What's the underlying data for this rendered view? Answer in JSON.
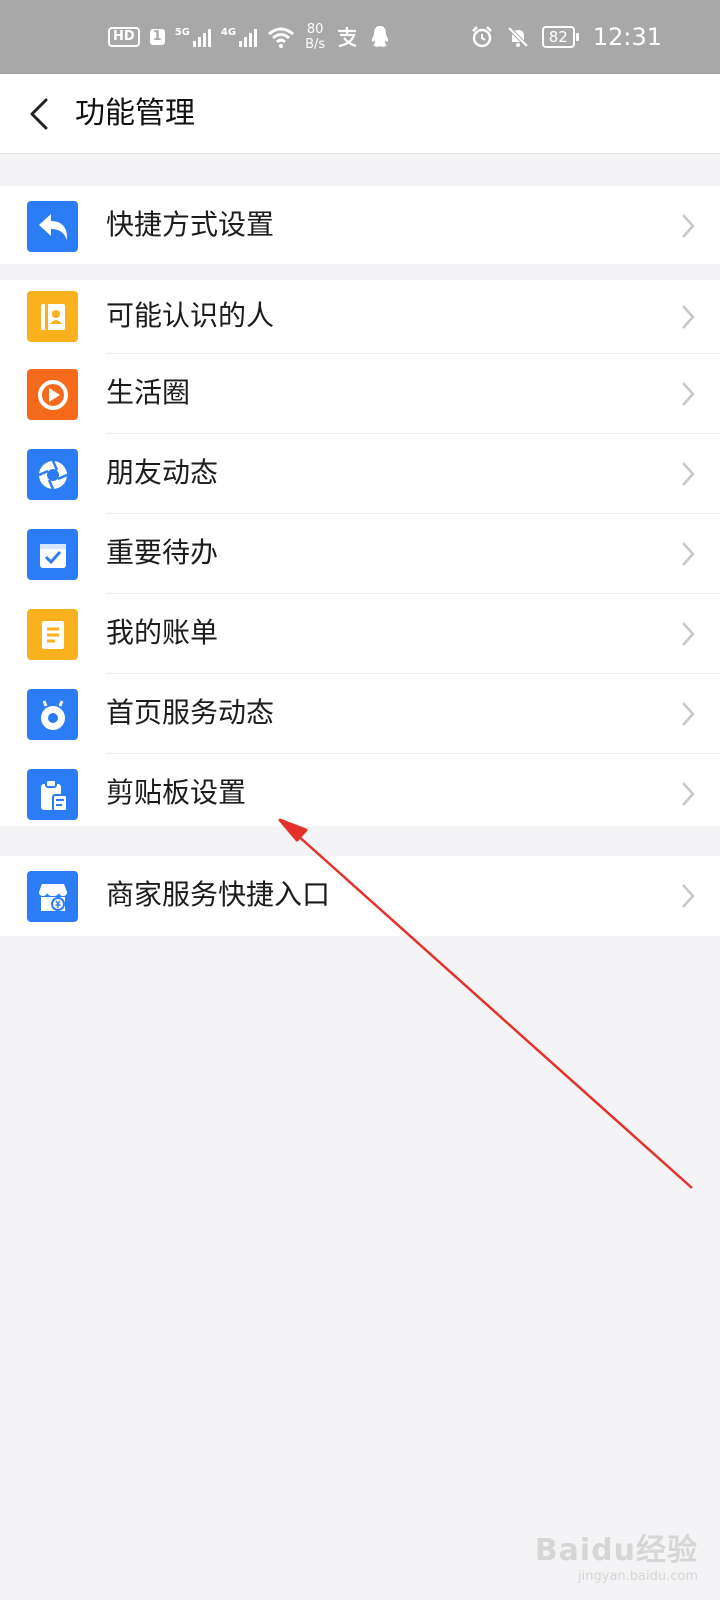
{
  "status_bar": {
    "hd": "HD",
    "sim": "1",
    "net1": "5G",
    "net2": "4G",
    "speed_value": "80",
    "speed_unit": "B/s",
    "battery": "82",
    "time": "12:31",
    "icons": [
      "wifi-icon",
      "alipay-icon",
      "qq-icon",
      "alarm-icon",
      "mute-bell-icon",
      "battery-icon"
    ]
  },
  "header": {
    "title": "功能管理",
    "back_icon": "chevron-left-icon"
  },
  "groups": [
    {
      "items": [
        {
          "label": "快捷方式设置",
          "icon": "reply-arrow-icon",
          "color": "#2c7cf6"
        }
      ]
    },
    {
      "items": [
        {
          "label": "可能认识的人",
          "icon": "contact-card-icon",
          "color": "#f9b21d"
        },
        {
          "label": "生活圈",
          "icon": "play-circle-icon",
          "color": "#f66a1c"
        },
        {
          "label": "朋友动态",
          "icon": "aperture-icon",
          "color": "#2c7cf6"
        },
        {
          "label": "重要待办",
          "icon": "checkbox-icon",
          "color": "#2c7cf6"
        },
        {
          "label": "我的账单",
          "icon": "bill-icon",
          "color": "#f9b21d"
        },
        {
          "label": "首页服务动态",
          "icon": "service-bell-icon",
          "color": "#2c7cf6"
        },
        {
          "label": "剪贴板设置",
          "icon": "clipboard-icon",
          "color": "#2c7cf6"
        }
      ]
    },
    {
      "items": [
        {
          "label": "商家服务快捷入口",
          "icon": "store-icon",
          "color": "#2c7cf6"
        }
      ]
    }
  ],
  "annotation": {
    "color": "#e5312b"
  },
  "watermark": {
    "main": "Baidu经验",
    "sub": "jingyan.baidu.com"
  }
}
